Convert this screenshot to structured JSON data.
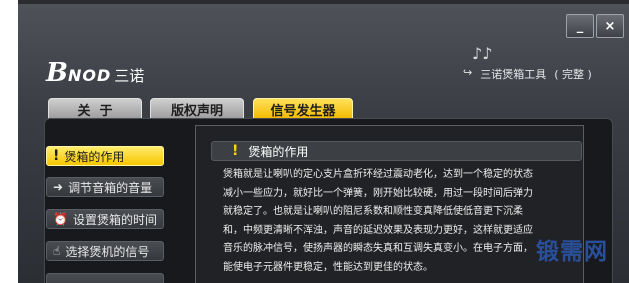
{
  "window": {
    "minimize_label": "_",
    "close_label": "×"
  },
  "brand": {
    "logo_b": "B",
    "logo_nod": "NOD",
    "logo_cn": "三诺",
    "tool_title": "三诺煲箱工具",
    "tool_edition": "( 完整 )",
    "notes_glyph": "♪♪"
  },
  "tabs": [
    {
      "label": "关  于",
      "active": false
    },
    {
      "label": "版权声明",
      "active": false
    },
    {
      "label": "信号发生器",
      "active": true
    }
  ],
  "sidebar": {
    "items": [
      {
        "label": "煲箱的作用",
        "icon": "exclamation-icon",
        "glyph": "!",
        "active": true
      },
      {
        "label": "调节音箱的音量",
        "icon": "volume-icon",
        "glyph": "➜",
        "active": false
      },
      {
        "label": "设置煲箱的时间",
        "icon": "alarm-clock-icon",
        "glyph": "⏰",
        "active": false
      },
      {
        "label": "选择煲机的信号",
        "icon": "hand-pointer-icon",
        "glyph": "☝",
        "active": false
      }
    ]
  },
  "content": {
    "title": "煲箱的作用",
    "title_glyph": "!",
    "body": "煲箱就是让喇叭的定心支片盒折环经过震动老化，达到一个稳定的状态\n减小一些应力，就好比一个弹簧，刚开始比较硬，用过一段时间后弹力\n就稳定了。也就是让喇叭的阻尼系数和顺性变真降低使低音更下沉柔\n和，中频更清晰不浑浊，声音的延迟效果及表现力更好，这样就更适应\n音乐的脉冲信号，使扬声器的瞬态失真和互调失真变小。在电子方面，\n能使电子元器件更稳定，性能达到更佳的状态。"
  },
  "watermark": "锻需网",
  "colors": {
    "accent_yellow": "#f7c600",
    "panel_bg": "#17191c",
    "window_bg": "#3a3e44"
  }
}
